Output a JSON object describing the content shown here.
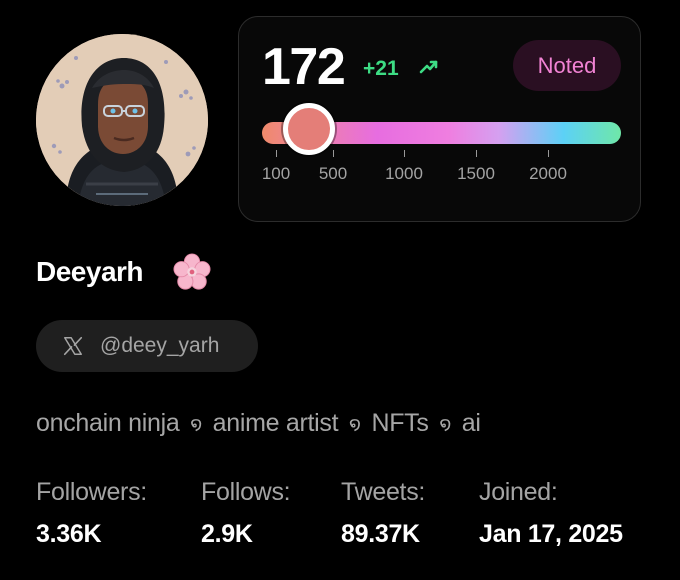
{
  "profile": {
    "display_name": "Deeyarh",
    "name_emoji_icon": "cherry-blossom-icon",
    "handle": "@deey_yarh",
    "handle_platform_icon": "x-logo-icon",
    "bio": {
      "items": [
        "onchain ninja",
        "anime artist",
        "NFTs",
        "ai"
      ],
      "separator": "໑"
    },
    "avatar_icon": "anime-avatar-hijab-glasses"
  },
  "score_card": {
    "value": "172",
    "delta": "+21",
    "delta_icon": "trending-up-icon",
    "badge": "Noted",
    "scale_ticks": [
      "100",
      "500",
      "1000",
      "1500",
      "2000"
    ],
    "slider_value": 172,
    "colors": {
      "delta": "#3ddc84",
      "badge_text": "#f183d4",
      "badge_bg": "#2a0f22",
      "knob": "#e47e78"
    }
  },
  "stats": [
    {
      "label": "Followers:",
      "value": "3.36K"
    },
    {
      "label": "Follows:",
      "value": "2.9K"
    },
    {
      "label": "Tweets:",
      "value": "89.37K"
    },
    {
      "label": "Joined:",
      "value": "Jan 17, 2025"
    }
  ]
}
